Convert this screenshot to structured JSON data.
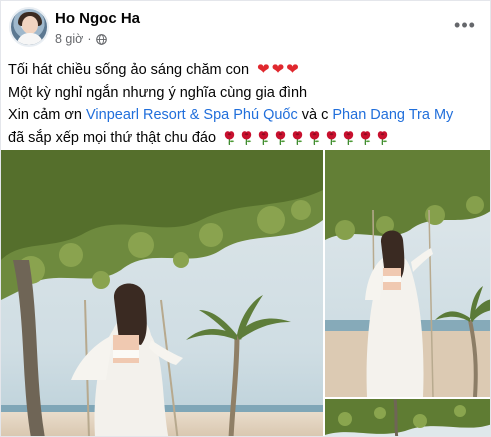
{
  "post": {
    "author": "Ho Ngoc Ha",
    "timestamp": "8 giờ",
    "privacy_icon": "globe-icon",
    "more_icon": "more-horizontal-icon",
    "lines": {
      "line1": "Tối hát chiều sống ảo sáng chăm con",
      "line2": "Một kỳ nghỉ ngắn nhưng ý nghĩa cùng gia đình",
      "line3_prefix": "Xin cảm ơn ",
      "line3_link1": "Vinpearl Resort & Spa Phú Quốc",
      "line3_middle": " và c ",
      "line3_link2": "Phan Dang Tra My",
      "line4": "đã sắp xếp mọi thứ thật chu đáo"
    },
    "heart_emoji": "❤",
    "rose_count": 10
  },
  "photos": [
    {
      "name": "beach-swing-photo-1"
    },
    {
      "name": "beach-swing-photo-2"
    },
    {
      "name": "tree-canopy-photo-3"
    }
  ],
  "colors": {
    "link": "#216fdb",
    "secondary_text": "#65676b",
    "heart": "#e0282e",
    "rose": "#c8102e"
  }
}
